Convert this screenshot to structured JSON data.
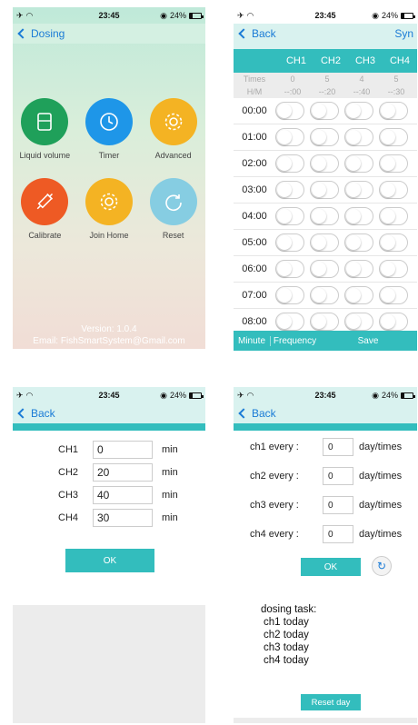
{
  "screen1": {
    "status": {
      "time": "23:45",
      "battery": "24%",
      "battery_level": 0.24
    },
    "nav": {
      "back_label": "Dosing"
    },
    "tiles": [
      {
        "label": "Liquid volume",
        "icon": "beaker-icon",
        "color": "#1fa05a"
      },
      {
        "label": "Timer",
        "icon": "clock-icon",
        "color": "#1e96e8"
      },
      {
        "label": "Advanced",
        "icon": "gear-icon",
        "color": "#f4b323"
      },
      {
        "label": "Calibrate",
        "icon": "syringe-icon",
        "color": "#ee5a24"
      },
      {
        "label": "Join Home",
        "icon": "gear-icon",
        "color": "#f4b323"
      },
      {
        "label": "Reset",
        "icon": "refresh-icon",
        "color": "#86cde2"
      }
    ],
    "version": "Version: 1.0.4",
    "email": "Email: FishSmartSystem@Gmail.com"
  },
  "screen2": {
    "status": {
      "time": "23:45",
      "battery": "24%"
    },
    "nav": {
      "back_label": "Back",
      "right_label": "Syn"
    },
    "channels": [
      "CH1",
      "CH2",
      "CH3",
      "CH4"
    ],
    "times_label": "Times",
    "times": [
      "0",
      "5",
      "4",
      "5"
    ],
    "hm_label": "H/M",
    "hm": [
      "--:00",
      "--:20",
      "--:40",
      "--:30"
    ],
    "hours": [
      "00:00",
      "01:00",
      "02:00",
      "03:00",
      "04:00",
      "05:00",
      "06:00",
      "07:00",
      "08:00"
    ],
    "bottom": {
      "minute": "Minute",
      "frequency": "Frequency",
      "save": "Save"
    }
  },
  "screen3": {
    "status": {
      "time": "23:45",
      "battery": "24%"
    },
    "nav": {
      "back_label": "Back"
    },
    "rows": [
      {
        "label": "CH1",
        "value": "0",
        "unit": "min"
      },
      {
        "label": "CH2",
        "value": "20",
        "unit": "min"
      },
      {
        "label": "CH3",
        "value": "40",
        "unit": "min"
      },
      {
        "label": "CH4",
        "value": "30",
        "unit": "min"
      }
    ],
    "ok_label": "OK"
  },
  "screen4": {
    "status": {
      "time": "23:45",
      "battery": "24%"
    },
    "nav": {
      "back_label": "Back"
    },
    "rows": [
      {
        "label": "ch1 every :",
        "value": "0",
        "unit": "day/times"
      },
      {
        "label": "ch2 every :",
        "value": "0",
        "unit": "day/times"
      },
      {
        "label": "ch3 every :",
        "value": "0",
        "unit": "day/times"
      },
      {
        "label": "ch4 every :",
        "value": "0",
        "unit": "day/times"
      }
    ],
    "ok_label": "OK",
    "task_title": "dosing task:",
    "tasks": [
      "ch1 today",
      "ch2 today",
      "ch3 today",
      "ch4 today"
    ],
    "reset_label": "Reset day"
  }
}
